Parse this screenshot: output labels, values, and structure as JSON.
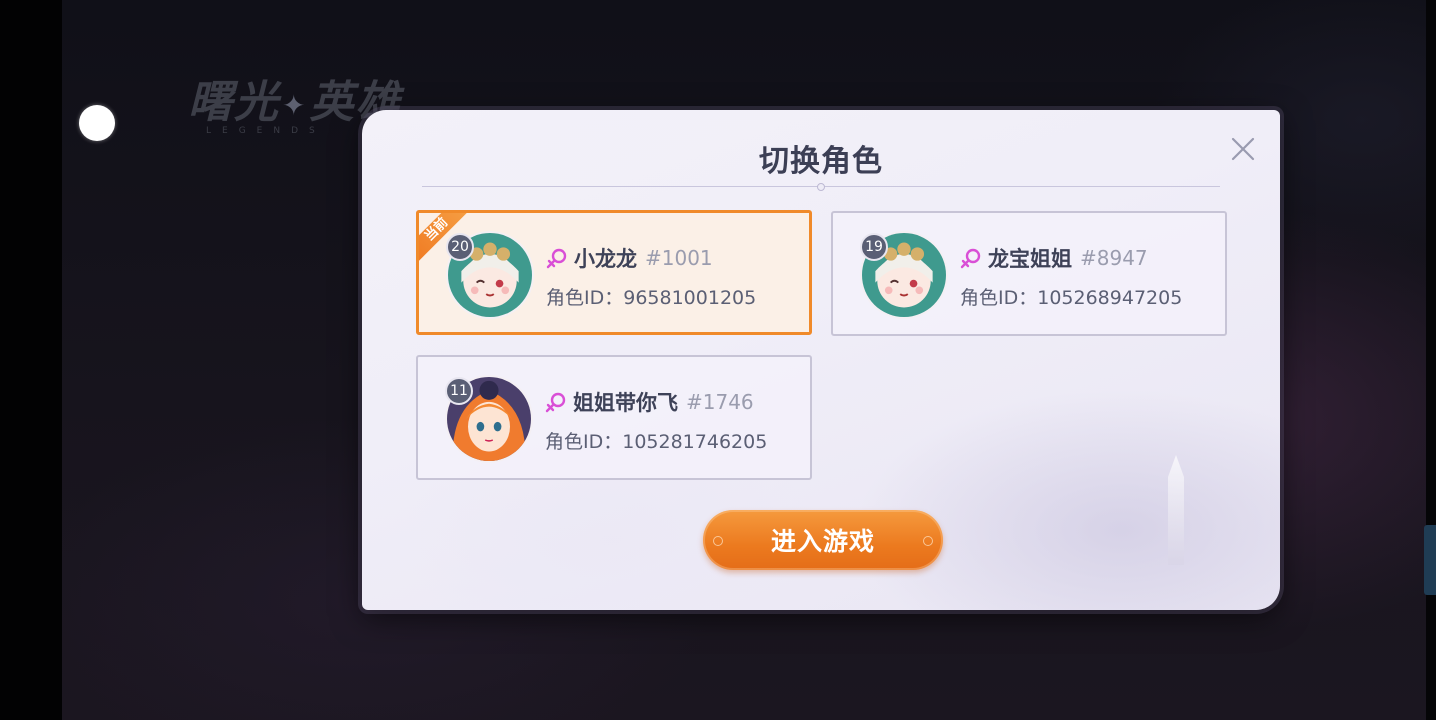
{
  "background": {
    "logo": {
      "main_left": "曙光",
      "main_right": "英雄",
      "sub": "LEGENDS"
    },
    "footer_lines": [
      "",
      "",
      ""
    ]
  },
  "dialog": {
    "title": "切换角色",
    "close_icon": "close-icon",
    "current_label": "当前",
    "id_prefix": "角色ID：",
    "roles": [
      {
        "level": "20",
        "name": "小龙龙",
        "tag": "#1001",
        "id": "96581001205",
        "gender": "female",
        "selected": true
      },
      {
        "level": "19",
        "name": "龙宝姐姐",
        "tag": "#8947",
        "id": "105268947205",
        "gender": "female",
        "selected": false
      },
      {
        "level": "11",
        "name": "姐姐带你飞",
        "tag": "#1746",
        "id": "105281746205",
        "gender": "female",
        "selected": false
      }
    ],
    "enter_button": "进入游戏"
  },
  "colors": {
    "accent_orange": "#f08a2a",
    "gender_pink": "#d94fd6",
    "title_text": "#3c3f55"
  }
}
